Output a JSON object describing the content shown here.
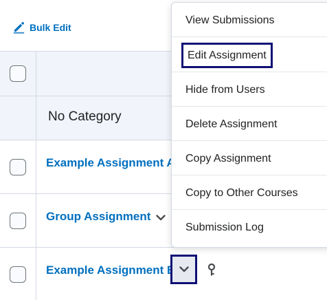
{
  "toolbar": {
    "bulk_edit_label": "Bulk Edit",
    "bulk_edit_icon": "pencil-icon"
  },
  "table": {
    "category_label": "No Category",
    "rows": [
      {
        "name": "Example Assignment A"
      },
      {
        "name": "Group Assignment"
      },
      {
        "name": "Example Assignment B"
      }
    ]
  },
  "context_menu": {
    "items": [
      {
        "label": "View Submissions"
      },
      {
        "label": "Edit Assignment",
        "focused": true
      },
      {
        "label": "Hide from Users"
      },
      {
        "label": "Delete Assignment"
      },
      {
        "label": "Copy Assignment"
      },
      {
        "label": "Copy to Other Courses"
      },
      {
        "label": "Submission Log"
      }
    ]
  },
  "colors": {
    "link": "#006fbf",
    "focus_ring": "#0f0f74",
    "header_bg": "#f1f5fb",
    "border": "#d3d9e3"
  }
}
